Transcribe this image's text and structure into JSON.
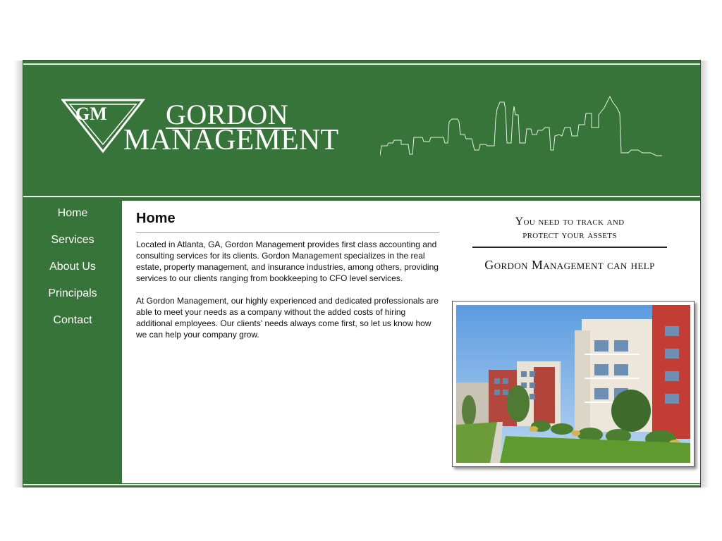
{
  "header": {
    "logo_monogram": "GM",
    "logo_line1": "GORDON",
    "logo_line2": "MANAGEMENT"
  },
  "nav": {
    "items": [
      {
        "label": "Home"
      },
      {
        "label": "Services"
      },
      {
        "label": "About Us"
      },
      {
        "label": "Principals"
      },
      {
        "label": "Contact"
      }
    ]
  },
  "main": {
    "title": "Home",
    "paragraphs": [
      "Located in Atlanta, GA, Gordon Management provides first class accounting and consulting services for its clients. Gordon Management specializes in the real estate, property management, and insurance industries, among others, providing services to our clients ranging from bookkeeping to CFO level services.",
      "At Gordon Management, our highly experienced and dedicated professionals are able to meet your needs as a company without the added costs of hiring additional employees. Our clients' needs always come first, so let us know how we can help your company grow."
    ]
  },
  "tagline": {
    "line1": "You need to track and",
    "line2": "protect your assets",
    "line3": "Gordon Management can help"
  },
  "colors": {
    "brand_green": "#377439",
    "rule_light": "#e7efe6"
  }
}
